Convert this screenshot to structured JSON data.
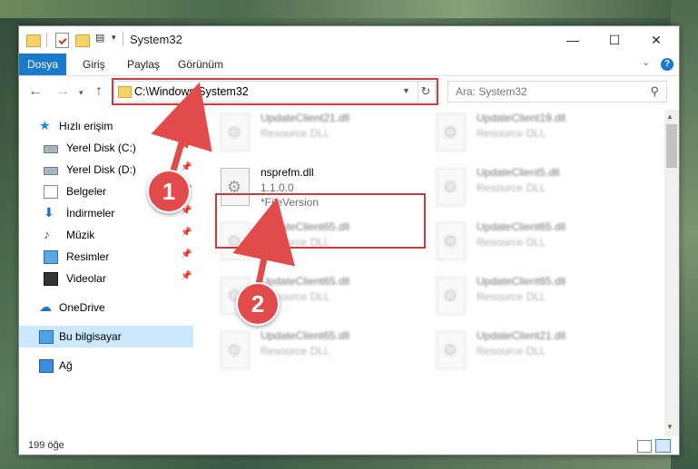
{
  "title": "System32",
  "ribbon": {
    "file": "Dosya",
    "tabs": [
      "Giriş",
      "Paylaş",
      "Görünüm"
    ],
    "help": "?"
  },
  "address": {
    "path": "C:\\Windows\\System32",
    "search_placeholder": "Ara: System32"
  },
  "sidebar": {
    "quick_access": "Hızlı erişim",
    "items": [
      "Yerel Disk (C:)",
      "Yerel Disk (D:)",
      "Belgeler",
      "İndirmeler",
      "Müzik",
      "Resimler",
      "Videolar"
    ],
    "onedrive": "OneDrive",
    "this_pc": "Bu bilgisayar",
    "network": "Ağ"
  },
  "files": [
    {
      "name": "UpdateClient21.dll",
      "type": "Resource DLL"
    },
    {
      "name": "UpdateClient19.dll",
      "type": "Resource DLL"
    },
    {
      "name": "nsprefm.dll",
      "version": "1.1.0.0",
      "extra": "*FileVersion"
    },
    {
      "name": "UpdateClient5.dll",
      "type": "Resource DLL"
    },
    {
      "name": "UpdateClient65.dll",
      "type": "Resource DLL"
    },
    {
      "name": "UpdateClient65.dll",
      "type": "Resource DLL"
    },
    {
      "name": "UpdateClient65.dll",
      "type": "Resource DLL"
    },
    {
      "name": "UpdateClient65.dll",
      "type": "Resource DLL"
    },
    {
      "name": "UpdateClient65.dll",
      "type": "Resource DLL"
    },
    {
      "name": "UpdateClient21.dll",
      "type": "Resource DLL"
    }
  ],
  "status": "199 öğe",
  "annotations": [
    "1",
    "2"
  ],
  "colors": {
    "accent": "#1979ca",
    "highlight": "#d23a3a",
    "badge": "#e24b4b"
  }
}
